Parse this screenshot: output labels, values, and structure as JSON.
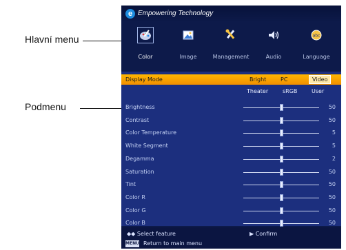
{
  "annotations": {
    "main_menu": "Hlavní menu",
    "submenu": "Podmenu"
  },
  "osd": {
    "brand": "Empowering Technology",
    "tabs": [
      {
        "label": "Color",
        "icon": "color-palette-icon",
        "active": true
      },
      {
        "label": "Image",
        "icon": "picture-icon",
        "active": false
      },
      {
        "label": "Management",
        "icon": "tools-icon",
        "active": false
      },
      {
        "label": "Audio",
        "icon": "speaker-icon",
        "active": false
      },
      {
        "label": "Language",
        "icon": "language-icon",
        "active": false
      }
    ],
    "display_mode": {
      "label": "Display Mode",
      "options_row1": [
        "Bright",
        "PC",
        "Video"
      ],
      "options_row2": [
        "Theater",
        "sRGB",
        "User"
      ],
      "selected": "Video"
    },
    "settings": [
      {
        "label": "Brightness",
        "value": "50",
        "level": 0.5
      },
      {
        "label": "Contrast",
        "value": "50",
        "level": 0.5
      },
      {
        "label": "Color Temperature",
        "value": "5",
        "level": 0.5
      },
      {
        "label": "White Segment",
        "value": "5",
        "level": 0.5
      },
      {
        "label": "Degamma",
        "value": "2",
        "level": 0.5
      },
      {
        "label": "Saturation",
        "value": "50",
        "level": 0.5
      },
      {
        "label": "Tint",
        "value": "50",
        "level": 0.5
      },
      {
        "label": "Color R",
        "value": "50",
        "level": 0.5
      },
      {
        "label": "Color G",
        "value": "50",
        "level": 0.5
      },
      {
        "label": "Color B",
        "value": "50",
        "level": 0.5
      }
    ],
    "footer": {
      "select": "Select feature",
      "confirm": "Confirm",
      "menu_key": "MENU",
      "return": "Return to main menu"
    }
  },
  "colors": {
    "highlight": "#f7a600",
    "panel": "#1c2f7e",
    "background": "#0d1a4a"
  }
}
